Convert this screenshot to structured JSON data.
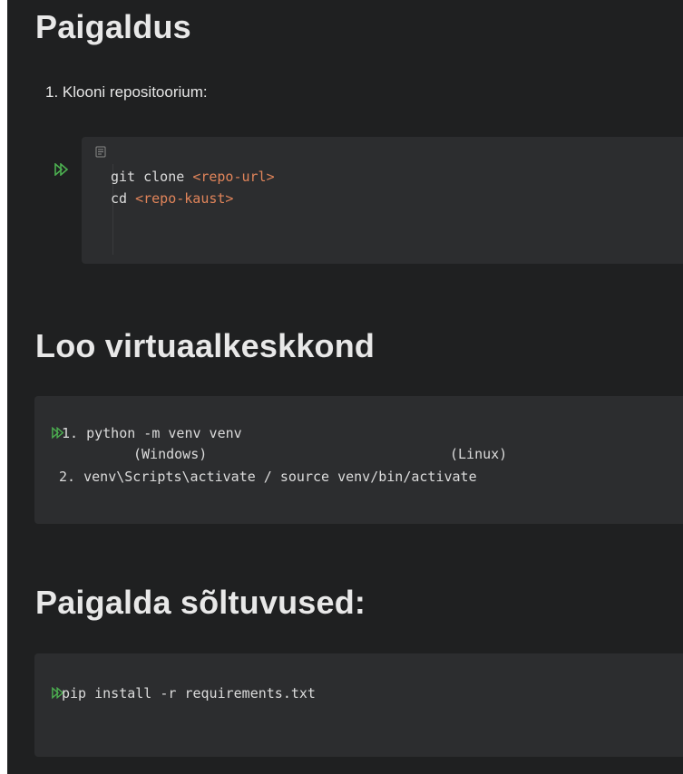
{
  "sections": {
    "install": {
      "title": "Paigaldus",
      "step_number": "1.",
      "step_text": "Klooni repositoorium:",
      "code": {
        "line1_cmd": "git clone ",
        "line1_arg": "<repo-url>",
        "line2_cmd": "cd ",
        "line2_arg": "<repo-kaust>"
      }
    },
    "venv": {
      "title": "Loo virtuaalkeskkond",
      "code": {
        "line1": "1. python -m venv venv",
        "line2_windows": "(Windows)",
        "line2_linux": "(Linux)",
        "line3": " 2. venv\\Scripts\\activate / source venv/bin/activate"
      }
    },
    "deps": {
      "title": "Paigalda sõltuvused:",
      "code": {
        "line1": "pip install -r requirements.txt"
      }
    }
  },
  "colors": {
    "background": "#1f2021",
    "code_background": "#2c2d2f",
    "text": "#e8e8e8",
    "code_text": "#dcdcdc",
    "string_accent": "#e0845a",
    "run_icon": "#4caf50"
  },
  "icons": {
    "run": "run-icon",
    "copy": "copy-icon"
  }
}
